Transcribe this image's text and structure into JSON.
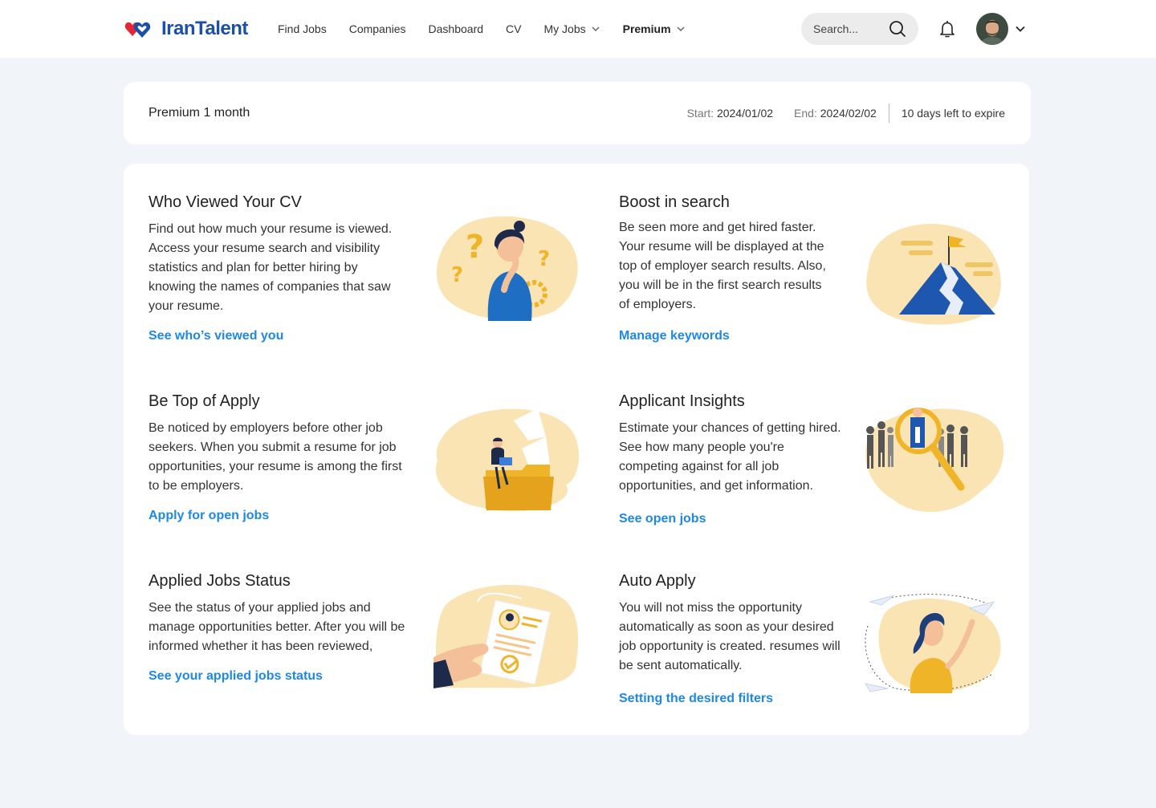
{
  "brand": {
    "name": "IranTalent",
    "red": "#e32636",
    "blue": "#1b4fa8",
    "link_color": "#1e88e5"
  },
  "nav": {
    "find_jobs": "Find Jobs",
    "companies": "Companies",
    "dashboard": "Dashboard",
    "cv": "CV",
    "my_jobs": "My Jobs",
    "premium": "Premium"
  },
  "search": {
    "placeholder": "Search..."
  },
  "icons": [
    "search-icon",
    "bell-icon",
    "chevron-down-icon",
    "avatar"
  ],
  "summary": {
    "plan": "Premium 1 month",
    "start_label": "Start:",
    "start_value": "2024/01/02",
    "end_label": "End:",
    "end_value": "2024/02/02",
    "expire": "10 days left to expire"
  },
  "features": [
    {
      "title": "Who Viewed Your CV",
      "description": "Find out how much your resume is viewed. Access your resume search and visibility statistics and plan for better hiring by knowing the names of companies that saw your resume.",
      "link": "See who’s viewed you"
    },
    {
      "title": "Boost in search",
      "description": "Be seen more and get hired faster. Your resume will be displayed at the top of employer search results. Also, you will be in the first search results of employers.",
      "link": "Manage keywords"
    },
    {
      "title": "Be Top of Apply",
      "description": "Be noticed by employers before other job seekers. When you submit a resume for job opportunities, your resume is among the first to be employers.",
      "link": "Apply for open jobs"
    },
    {
      "title": "Applicant Insights",
      "description": "Estimate your chances of getting hired. See how many people you're competing against for all job opportunities, and get information.",
      "link": "See open jobs"
    },
    {
      "title": "Applied Jobs Status",
      "description": "See the status of your applied jobs and manage opportunities better. After you will be informed whether it has been reviewed,",
      "link": "See your applied jobs status"
    },
    {
      "title": "Auto Apply",
      "description": "You will not miss the opportunity automatically as soon as your desired job opportunity is created. resumes will be sent automatically.",
      "link": "Setting the desired filters"
    }
  ]
}
